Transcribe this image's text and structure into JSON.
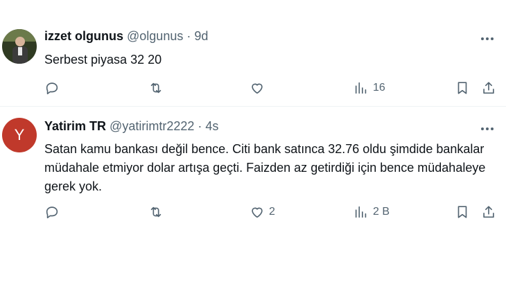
{
  "tweets": [
    {
      "name": "izzet olgunus",
      "handle": "@olgunus",
      "separator": "·",
      "time": "9d",
      "text": "Serbest piyasa 32 20",
      "avatar_letter": "",
      "actions": {
        "replies": "",
        "reposts": "",
        "likes": "",
        "views": "16"
      }
    },
    {
      "name": "Yatirim TR",
      "handle": "@yatirimtr2222",
      "separator": "·",
      "time": "4s",
      "text": "Satan kamu bankası değil bence. Citi bank satınca 32.76 oldu şimdide bankalar müdahale etmiyor dolar artışa geçti. Faizden az getirdiği için bence müdahaleye gerek yok.",
      "avatar_letter": "Y",
      "avatar_color": "#c0392b",
      "actions": {
        "replies": "",
        "reposts": "",
        "likes": "2",
        "views": "2 B"
      }
    }
  ],
  "icons": [
    "reply-icon",
    "repost-icon",
    "like-icon",
    "views-icon",
    "bookmark-icon",
    "share-icon",
    "more-icon"
  ]
}
